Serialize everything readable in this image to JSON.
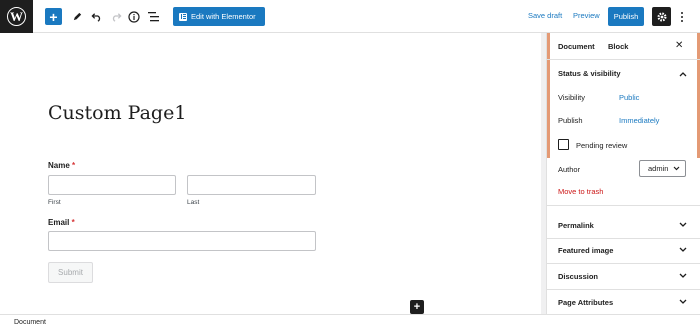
{
  "toolbar": {
    "wp_logo": "W",
    "add_icon": "+",
    "elementor_label": "Edit with Elementor",
    "save_draft_label": "Save draft",
    "preview_label": "Preview",
    "publish_label": "Publish",
    "icons": [
      "wordpress-icon",
      "plus-icon",
      "pencil-icon",
      "undo-icon",
      "redo-icon",
      "info-icon",
      "list-view-icon",
      "gear-icon",
      "more-vertical-icon"
    ]
  },
  "editor": {
    "page_title": "Custom Page1",
    "name_label": "Name",
    "required_mark": "*",
    "first_sublabel": "First",
    "last_sublabel": "Last",
    "email_label": "Email",
    "submit_label": "Submit",
    "inserter_icon": "+"
  },
  "sidebar": {
    "tabs": [
      "Document",
      "Block"
    ],
    "close_icon": "✕",
    "status_visibility": {
      "title": "Status & visibility",
      "visibility_label": "Visibility",
      "visibility_value": "Public",
      "publish_label": "Publish",
      "publish_value": "Immediately",
      "pending_review_label": "Pending review",
      "author_label": "Author",
      "author_value": "admin",
      "move_to_trash_label": "Move to trash"
    },
    "panels": [
      "Permalink",
      "Featured image",
      "Discussion",
      "Page Attributes"
    ]
  },
  "statusbar": {
    "label": "Document"
  },
  "colors": {
    "accent": "#1a79c0",
    "dark": "#1e1e1e",
    "trash": "#cc1818",
    "sidebar_accent": "#e49a75"
  }
}
